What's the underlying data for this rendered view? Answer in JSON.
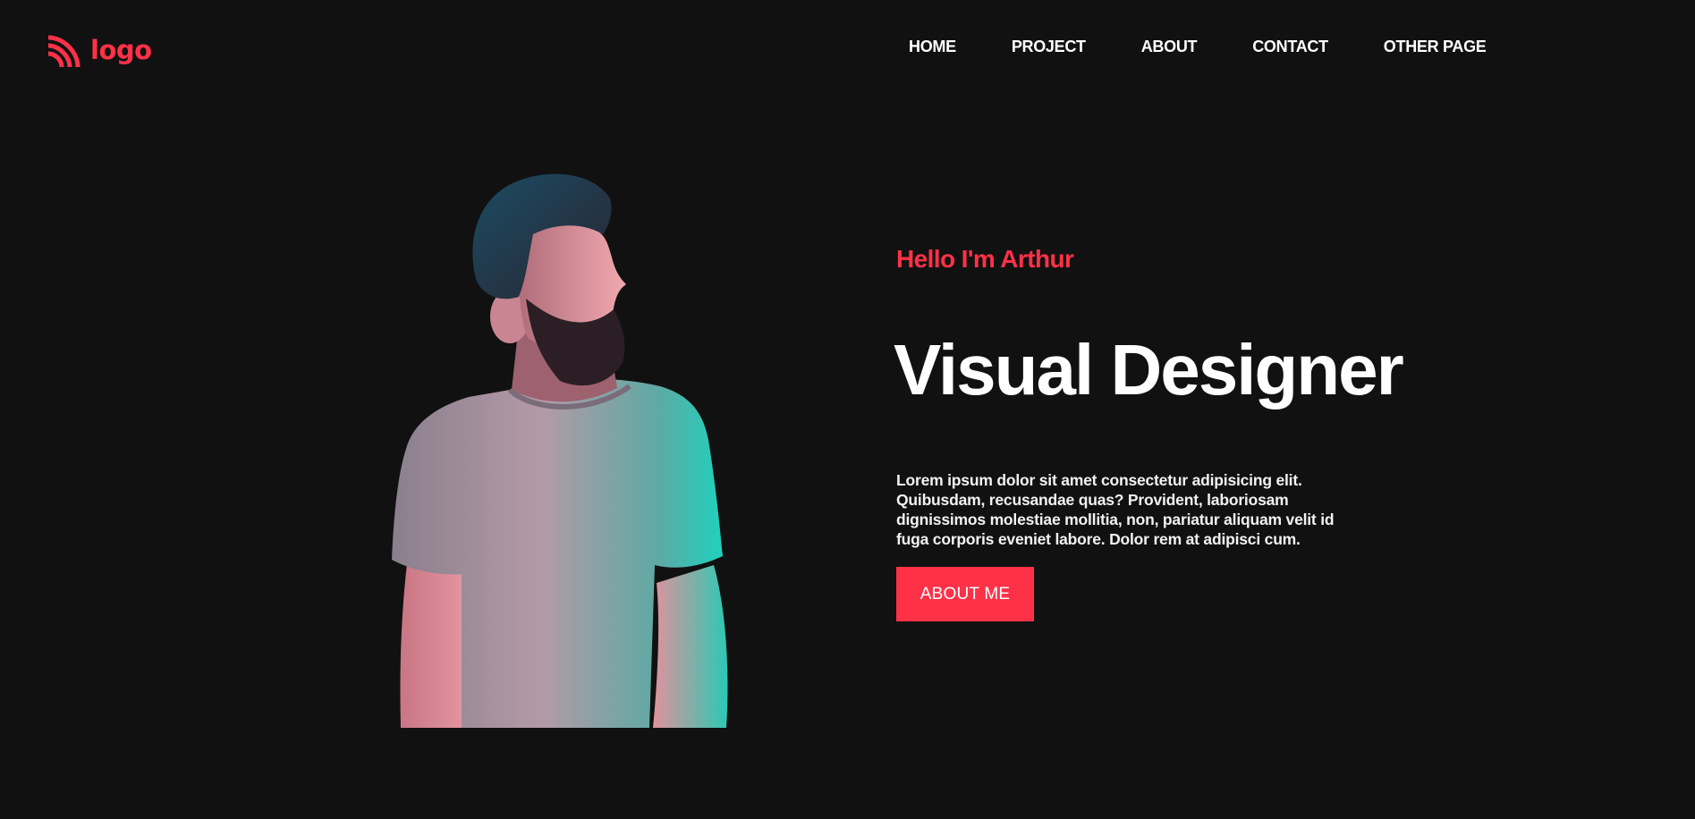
{
  "colors": {
    "background": "#111111",
    "accent": "#ff3147",
    "text": "#ffffff"
  },
  "header": {
    "logo": {
      "icon": "wifi-arcs-icon",
      "text": "logo"
    },
    "nav": {
      "items": [
        {
          "label": "HOME"
        },
        {
          "label": "PROJECT"
        },
        {
          "label": "ABOUT"
        },
        {
          "label": "CONTACT"
        },
        {
          "label": "OTHER PAGE"
        }
      ]
    }
  },
  "hero": {
    "portrait": {
      "icon": "portrait-photo"
    },
    "greeting": "Hello I'm Arthur",
    "title": "Visual Designer",
    "bio": "Lorem ipsum dolor sit amet consectetur adipisicing elit. Quibusdam, recusandae quas? Provident, laboriosam dignissimos molestiae mollitia, non, pariatur aliquam velit id fuga corporis eveniet labore. Dolor rem at adipisci cum.",
    "cta_label": "ABOUT ME"
  }
}
